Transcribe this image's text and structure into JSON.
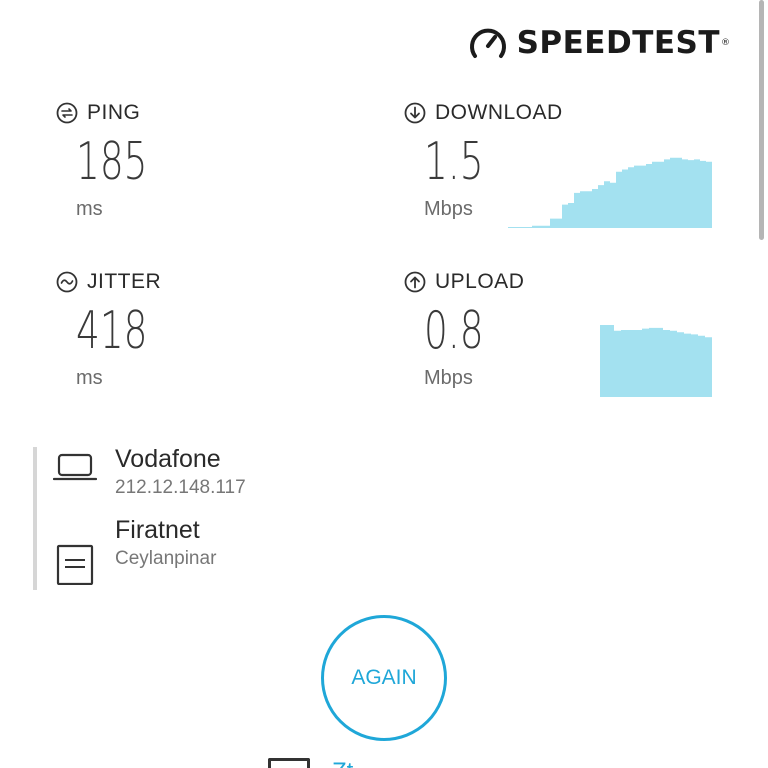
{
  "brand": {
    "name": "SPEEDTEST",
    "mark": "®",
    "icon": "gauge-icon"
  },
  "metrics": {
    "ping": {
      "label": "PING",
      "value": "185",
      "unit": "ms",
      "icon": "ping-icon"
    },
    "jitter": {
      "label": "JITTER",
      "value": "418",
      "unit": "ms",
      "icon": "jitter-icon"
    },
    "download": {
      "label": "DOWNLOAD",
      "value": "1.5",
      "unit": "Mbps",
      "icon": "download-arrow-icon"
    },
    "upload": {
      "label": "UPLOAD",
      "value": "0.8",
      "unit": "Mbps",
      "icon": "upload-arrow-icon"
    }
  },
  "graphs": {
    "color": "#a3e1f0",
    "download_samples": [
      0,
      0,
      0,
      0,
      0.03,
      0.03,
      0.03,
      0.12,
      0.12,
      0.3,
      0.32,
      0.45,
      0.47,
      0.47,
      0.5,
      0.55,
      0.6,
      0.58,
      0.72,
      0.75,
      0.78,
      0.8,
      0.8,
      0.82,
      0.85,
      0.85,
      0.88,
      0.9,
      0.9,
      0.88,
      0.87,
      0.88,
      0.86,
      0.85
    ],
    "upload_samples": [
      1.0,
      1.0,
      0.92,
      0.93,
      0.93,
      0.93,
      0.95,
      0.96,
      0.96,
      0.93,
      0.92,
      0.9,
      0.88,
      0.87,
      0.85,
      0.83
    ]
  },
  "server": {
    "isp": {
      "name": "Vodafone",
      "detail": "212.12.148.117",
      "icon": "laptop-icon"
    },
    "host": {
      "name": "Firatnet",
      "detail": "Ceylanpinar",
      "icon": "server-document-icon"
    }
  },
  "actions": {
    "again_label": "AGAIN"
  },
  "bottom": {
    "text": "Zt",
    "icon": "list-icon"
  },
  "colors": {
    "accent": "#1fa7d8",
    "graph_fill": "#a3e1f0",
    "text": "#2a2a2a",
    "muted": "#6b6b6b"
  }
}
